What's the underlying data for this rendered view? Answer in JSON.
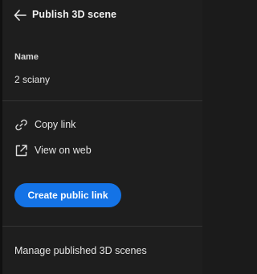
{
  "header": {
    "title": "Publish 3D scene",
    "back_icon": "arrow-left-icon"
  },
  "name_field": {
    "label": "Name",
    "value": "2 sciany"
  },
  "actions": [
    {
      "label": "Copy link",
      "icon": "link-icon"
    },
    {
      "label": "View on web",
      "icon": "external-link-icon"
    }
  ],
  "primary_button": {
    "label": "Create public link",
    "color": "#1473e6"
  },
  "footer": {
    "manage_label": "Manage published 3D scenes"
  },
  "colors": {
    "background": "#1e1e1e",
    "text": "#e6e6e6",
    "accent": "#1473e6"
  }
}
